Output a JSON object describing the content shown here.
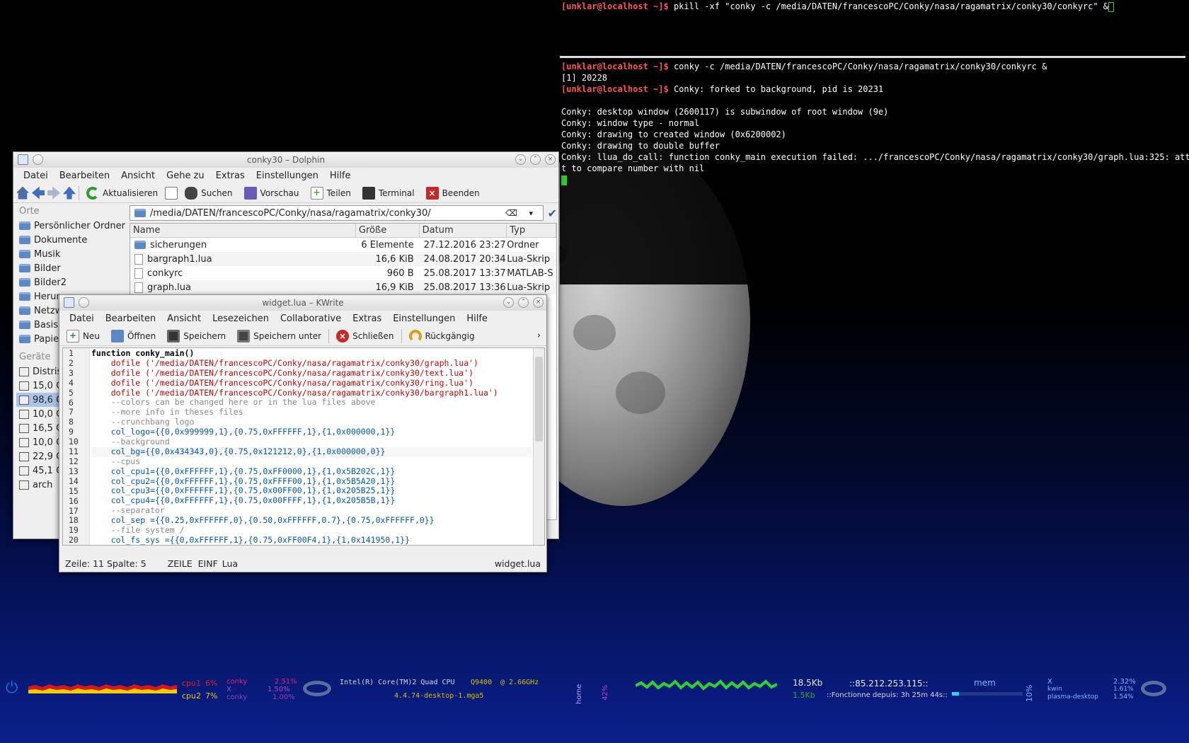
{
  "terminal": {
    "top_prompt": "[unklar@localhost ~]$",
    "top_cmd": " pkill -xf \"conky -c /media/DATEN/francescoPC/Conky/nasa/ragamatrix/conky30/conkyrc\" &",
    "lines": [
      {
        "prompt": "[unklar@localhost ~]$",
        "text": " conky -c /media/DATEN/francescoPC/Conky/nasa/ragamatrix/conky30/conkyrc &"
      },
      {
        "prompt": "",
        "text": "[1] 20228"
      },
      {
        "prompt": "[unklar@localhost ~]$",
        "text": " Conky: forked to background, pid is 20231"
      },
      {
        "prompt": "",
        "text": ""
      },
      {
        "prompt": "",
        "text": "Conky: desktop window (2600117) is subwindow of root window (9e)"
      },
      {
        "prompt": "",
        "text": "Conky: window type - normal"
      },
      {
        "prompt": "",
        "text": "Conky: drawing to created window (0x6200002)"
      },
      {
        "prompt": "",
        "text": "Conky: drawing to double buffer"
      },
      {
        "prompt": "",
        "text": "Conky: llua_do_call: function conky_main execution failed: .../francescoPC/Conky/nasa/ragamatrix/conky30/graph.lua:325: attemp"
      },
      {
        "prompt": "",
        "text": "t to compare number with nil"
      }
    ]
  },
  "dolphin": {
    "title": "conky30 – Dolphin",
    "menu": [
      "Datei",
      "Bearbeiten",
      "Ansicht",
      "Gehe zu",
      "Extras",
      "Einstellungen",
      "Hilfe"
    ],
    "toolbar": [
      "Aktualisieren",
      "Suchen",
      "Vorschau",
      "Teilen",
      "Terminal",
      "Beenden"
    ],
    "path": "/media/DATEN/francescoPC/Conky/nasa/ragamatrix/conky30/",
    "places_header": "Orte",
    "places": [
      "Persönlicher Ordner",
      "Dokumente",
      "Musik",
      "Bilder",
      "Bilder2",
      "Herun",
      "Netzw",
      "Basis",
      "Papie"
    ],
    "devices_header": "Geräte",
    "devices": [
      "Distris",
      "15,0 G",
      "98,6 G",
      "10,0 G",
      "16,5 G",
      "10,0 G",
      "22,9 G",
      "45,1 G",
      "arch"
    ],
    "columns": [
      "Name",
      "Größe",
      "Datum",
      "Typ"
    ],
    "files": [
      {
        "name": "sicherungen",
        "size": "6 Elemente",
        "date": "27.12.2016 23:27",
        "type": "Ordner",
        "folder": true
      },
      {
        "name": "bargraph1.lua",
        "size": "16,6 KiB",
        "date": "24.08.2017 20:34",
        "type": "Lua-Skrip",
        "folder": false
      },
      {
        "name": "conkyrc",
        "size": "960 B",
        "date": "25.08.2017 13:37",
        "type": "MATLAB-S",
        "folder": false
      },
      {
        "name": "graph.lua",
        "size": "16,9 KiB",
        "date": "25.08.2017 13:36",
        "type": "Lua-Skrip",
        "folder": false
      }
    ]
  },
  "kwrite": {
    "title": "widget.lua – KWrite",
    "menu": [
      "Datei",
      "Bearbeiten",
      "Ansicht",
      "Lesezeichen",
      "Collaborative",
      "Extras",
      "Einstellungen",
      "Hilfe"
    ],
    "toolbar": [
      "Neu",
      "Öffnen",
      "Speichern",
      "Speichern unter",
      "Schließen",
      "Rückgängig"
    ],
    "status_pos": "Zeile: 11 Spalte: 5",
    "status_mode": "ZEILE  EINF",
    "status_lang": "Lua",
    "status_file": "widget.lua",
    "code": [
      "function conky_main()",
      "    dofile ('/media/DATEN/francescoPC/Conky/nasa/ragamatrix/conky30/graph.lua')",
      "    dofile ('/media/DATEN/francescoPC/Conky/nasa/ragamatrix/conky30/text.lua')",
      "    dofile ('/media/DATEN/francescoPC/Conky/nasa/ragamatrix/conky30/ring.lua')",
      "    dofile ('/media/DATEN/francescoPC/Conky/nasa/ragamatrix/conky30/bargraph1.lua')",
      "    --colors can be changed here or in the lua files above",
      "    --more info in theses files",
      "    --crunchbang logo",
      "    col_logo={{0,0x999999,1},{0.75,0xFFFFFF,1},{1,0x000000,1}}",
      "    --background",
      "    col_bg={{0,0x434343,0},{0.75,0x121212,0},{1,0x000000,0}}",
      "    --cpus",
      "    col_cpu1={{0,0xFFFFFF,1},{0.75,0xFF0000,1},{1,0x5B202C,1}}",
      "    col_cpu2={{0,0xFFFFFF,1},{0.75,0xFFFF00,1},{1,0x5B5A20,1}}",
      "    col_cpu3={{0,0xFFFFFF,1},{0.75,0x00FF00,1},{1,0x205B25,1}}",
      "    col_cpu4={{0,0xFFFFFF,1},{0.75,0x00FFFF,1},{1,0x205B5B,1}}",
      "    --separator",
      "    col_sep ={{0.25,0xFFFFFF,0},{0.50,0xFFFFFF,0.7},{0.75,0xFFFFFF,0}}",
      "    --file system /",
      "    col_fs_sys ={{0,0xFFFFFF,1},{0.75,0xFF00F4,1},{1,0x141950,1}}"
    ]
  },
  "conky": {
    "cpu1_label": "cpu1",
    "cpu1_val": "6%",
    "cpu2_label": "cpu2",
    "cpu2_val": "7%",
    "proc1": "conky",
    "proc2": "X",
    "proc3": "conky",
    "p1": "2.51%",
    "p2": "1.50%",
    "p3": "1.00%",
    "cpu_model": "Intel(R) Core(TM)2 Quad CPU",
    "cpu_sku": "Q9400",
    "cpu_freq": "@ 2.66GHz",
    "kernel": "4.4.74-desktop-1.mga5",
    "home": "home",
    "home_pct": "42%",
    "net_down": "18.5Kb",
    "net_up": "1.5Kb",
    "ip": "::85.212.253.115::",
    "uptime": "::Fonctionne depuis: 3h 25m 44s::",
    "mem_label": "mem",
    "mem_pct": "10%",
    "mproc1": "X",
    "mproc2": "kwin",
    "mproc3": "plasma-desktop",
    "m1": "2.32%",
    "m2": "1.61%",
    "m3": "1.54%"
  }
}
